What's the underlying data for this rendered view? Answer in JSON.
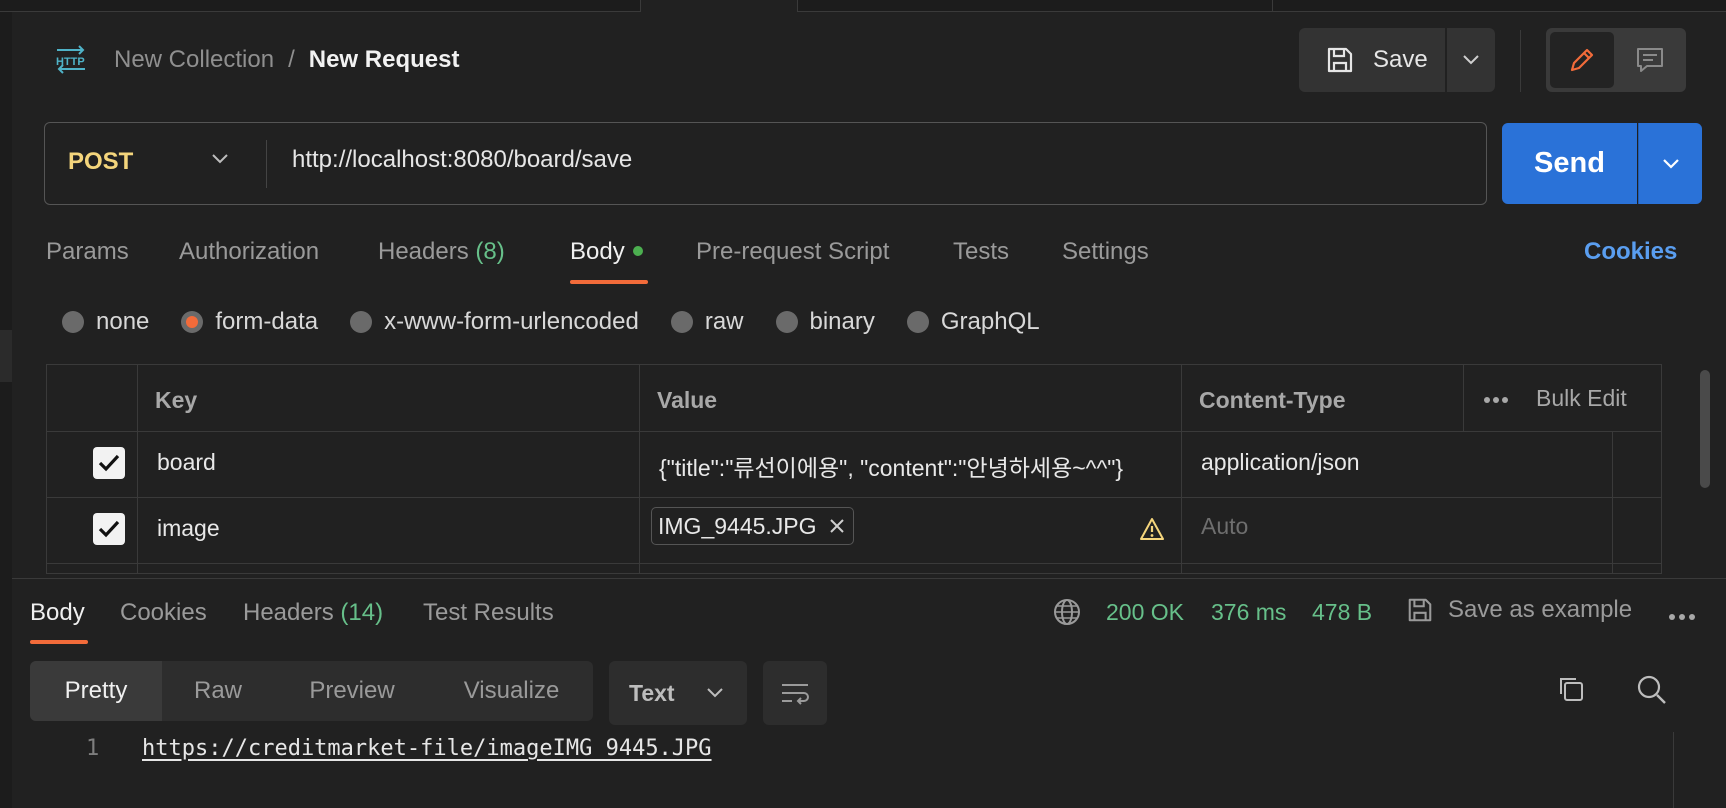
{
  "header": {
    "icon": "http-icon",
    "collection": "New Collection",
    "separator": "/",
    "request": "New Request",
    "save_label": "Save"
  },
  "request": {
    "method": "POST",
    "url": "http://localhost:8080/board/save",
    "send_label": "Send"
  },
  "request_tabs": {
    "params": "Params",
    "authorization": "Authorization",
    "headers": "Headers",
    "headers_count": "(8)",
    "body": "Body",
    "pre_request": "Pre-request Script",
    "tests": "Tests",
    "settings": "Settings",
    "cookies": "Cookies"
  },
  "body_types": [
    "none",
    "form-data",
    "x-www-form-urlencoded",
    "raw",
    "binary",
    "GraphQL"
  ],
  "body_type_selected": "form-data",
  "form_table": {
    "headers": {
      "key": "Key",
      "value": "Value",
      "content_type": "Content-Type",
      "bulk_edit": "Bulk Edit"
    },
    "rows": [
      {
        "checked": true,
        "key": "board",
        "value": "{\"title\":\"류선이에용\", \"content\":\"안녕하세용~^^\"}",
        "content_type": "application/json"
      },
      {
        "checked": true,
        "key": "image",
        "file": "IMG_9445.JPG",
        "content_type_placeholder": "Auto"
      }
    ]
  },
  "response": {
    "tabs": {
      "body": "Body",
      "cookies": "Cookies",
      "headers": "Headers",
      "headers_count": "(14)",
      "test_results": "Test Results"
    },
    "status": "200 OK",
    "time": "376 ms",
    "size": "478 B",
    "save_example": "Save as example",
    "formats": [
      "Pretty",
      "Raw",
      "Preview",
      "Visualize"
    ],
    "format_selected": "Pretty",
    "text_type": "Text",
    "lines": [
      {
        "no": "1",
        "text": "https://creditmarket-file/imageIMG_9445.JPG"
      }
    ]
  },
  "colors": {
    "accent_orange": "#f26b3a",
    "send_blue": "#2a72d8",
    "method_yellow": "#f4d57c",
    "status_green": "#67c08a",
    "link_blue": "#5a9ef0"
  }
}
